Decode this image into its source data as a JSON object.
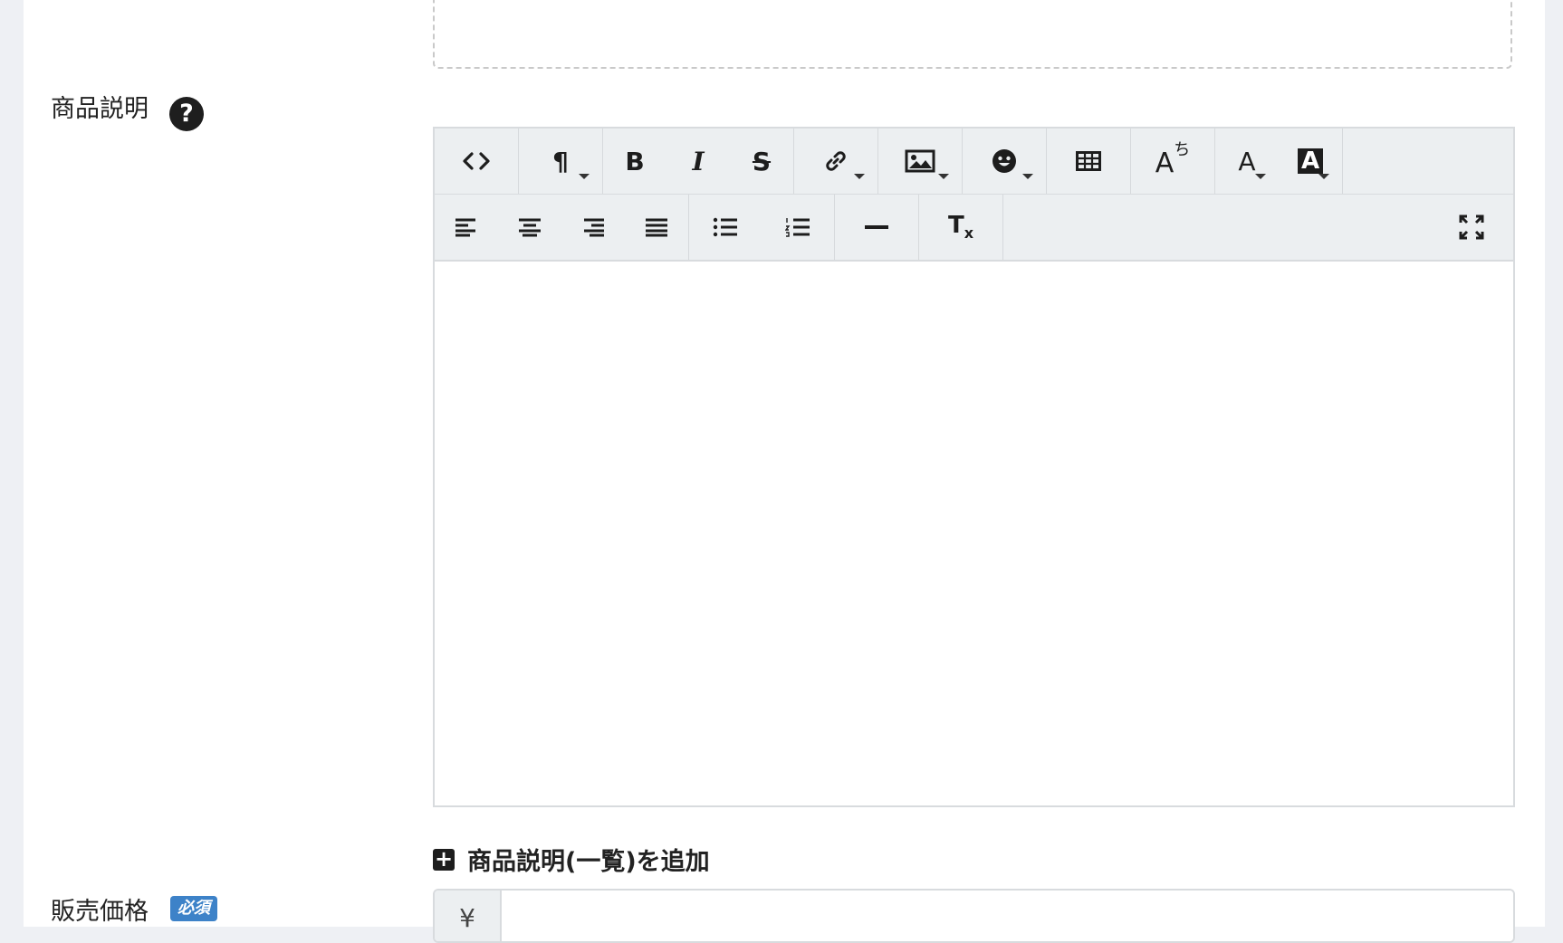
{
  "product_description": {
    "label": "商品説明",
    "help_icon": "question-circle-icon",
    "editor": {
      "toolbar_row1": [
        {
          "name": "code-view-icon",
          "glyph": "<>"
        },
        {
          "name": "paragraph-style-icon",
          "glyph": "¶",
          "dropdown": true
        },
        {
          "name": "bold-icon",
          "glyph": "B"
        },
        {
          "name": "italic-icon",
          "glyph": "I"
        },
        {
          "name": "strikethrough-icon",
          "glyph": "S"
        },
        {
          "name": "link-icon",
          "dropdown": true
        },
        {
          "name": "image-icon",
          "dropdown": true
        },
        {
          "name": "emoji-icon",
          "glyph": "☻",
          "dropdown": true
        },
        {
          "name": "table-icon"
        },
        {
          "name": "ruby-text-icon",
          "glyph": "A",
          "sup": "ち"
        },
        {
          "name": "font-color-icon",
          "glyph": "A",
          "dropdown": true
        },
        {
          "name": "background-color-icon",
          "glyph": "A",
          "dropdown": true
        }
      ],
      "toolbar_row2": [
        {
          "name": "align-left-icon"
        },
        {
          "name": "align-center-icon"
        },
        {
          "name": "align-right-icon"
        },
        {
          "name": "align-justify-icon"
        },
        {
          "name": "bullet-list-icon"
        },
        {
          "name": "numbered-list-icon"
        },
        {
          "name": "horizontal-rule-icon"
        },
        {
          "name": "clear-formatting-icon",
          "glyph": "T",
          "sub": "x"
        },
        {
          "name": "fullscreen-icon"
        }
      ],
      "content": ""
    },
    "add_list_description": "商品説明(一覧)を追加"
  },
  "sale_price": {
    "label": "販売価格",
    "required_badge": "必須",
    "currency_symbol": "¥",
    "value": ""
  },
  "colors": {
    "toolbar_bg": "#eceff1",
    "required_badge": "#3d82c8",
    "page_bg": "#eef0f4"
  }
}
